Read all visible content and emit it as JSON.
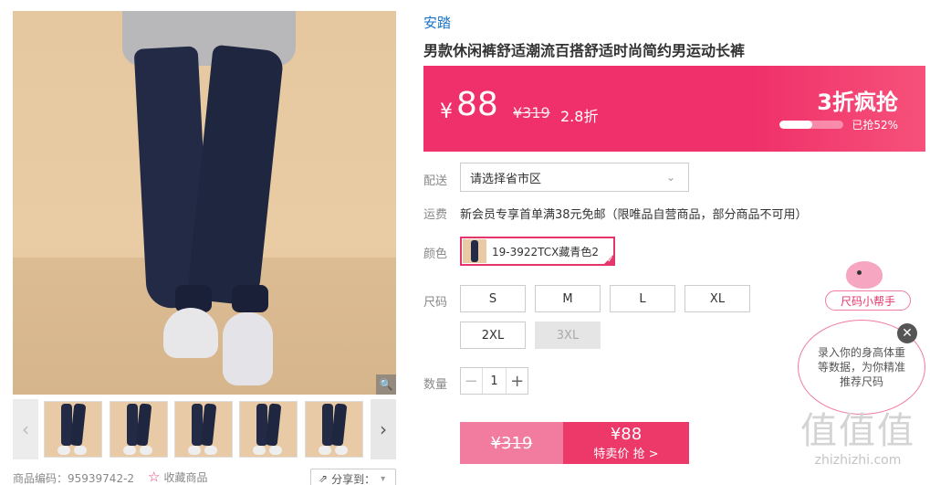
{
  "product": {
    "brand": "安踏",
    "title": "男款休闲裤舒适潮流百搭舒适时尚简约男运动长裤",
    "code_label": "商品编码：95939742-2",
    "favorite_label": "收藏商品",
    "share_label": "分享到："
  },
  "price": {
    "currency": "¥",
    "current": "88",
    "original": "¥319",
    "discount": "2.8折",
    "flash_label": "3折疯抢",
    "sold_label": "已抢52%",
    "sold_fraction": 0.52
  },
  "delivery": {
    "label": "配送",
    "placeholder": "请选择省市区",
    "freight_label": "运费",
    "freight_text": "新会员专享首单满38元免邮（限唯品自营商品，部分商品不可用）"
  },
  "color": {
    "label": "颜色",
    "selected": "19-3922TCX藏青色2"
  },
  "size": {
    "label": "尺码",
    "options": [
      "S",
      "M",
      "L",
      "XL",
      "2XL",
      "3XL"
    ],
    "disabled": [
      "3XL"
    ]
  },
  "quantity": {
    "label": "数量",
    "value": "1"
  },
  "buy": {
    "original": "¥319",
    "price": "¥88",
    "action": "特卖价 抢 >"
  },
  "helper": {
    "tag": "尺码小帮手",
    "text": "录入你的身高体重等数据，为你精准推荐尺码"
  },
  "watermark": {
    "logo": "值值值",
    "url": "zhizhizhi.com"
  },
  "colors": {
    "accent": "#f0306a",
    "brand_link": "#1a73c9"
  }
}
